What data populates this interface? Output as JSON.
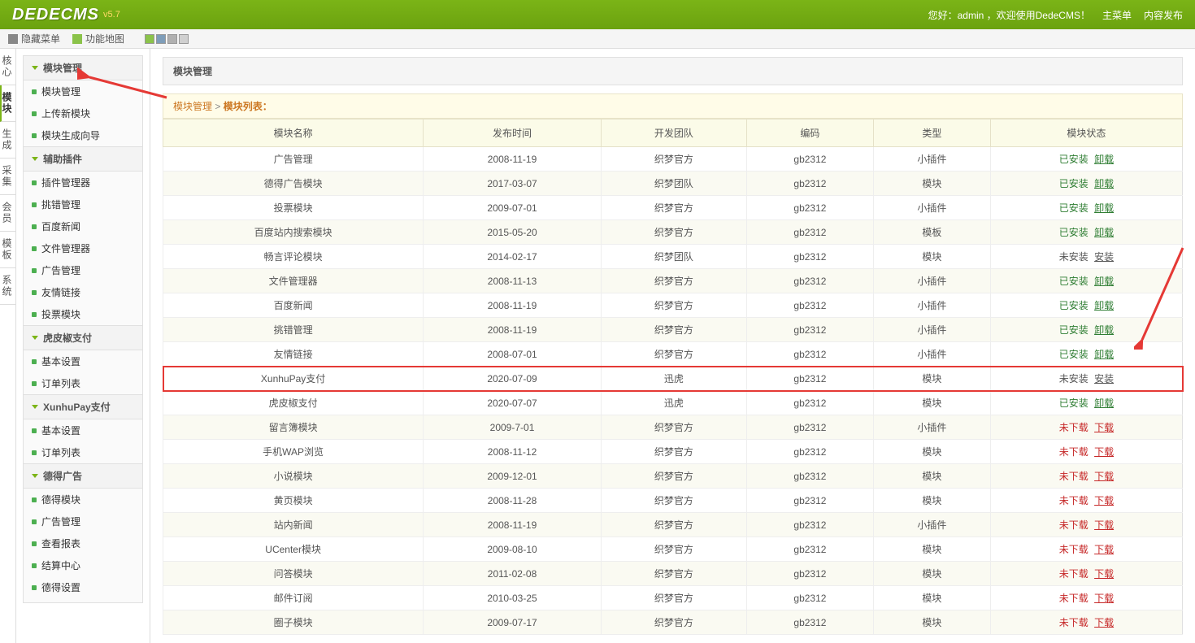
{
  "header": {
    "logo": "DEDECMS",
    "version": "v5.7",
    "welcome": "您好：admin ，欢迎使用DedeCMS！",
    "main_menu": "主菜单",
    "content_publish": "内容发布"
  },
  "toolbar": {
    "hide_menu": "隐藏菜单",
    "site_map": "功能地图"
  },
  "vert_tabs": [
    "核心",
    "模块",
    "生成",
    "采集",
    "会员",
    "模板",
    "系统"
  ],
  "vert_active_index": 1,
  "sidebar": [
    {
      "title": "模块管理",
      "items": [
        "模块管理",
        "上传新模块",
        "模块生成向导"
      ]
    },
    {
      "title": "辅助插件",
      "items": [
        "插件管理器",
        "挑错管理",
        "百度新闻",
        "文件管理器",
        "广告管理",
        "友情链接",
        "投票模块"
      ]
    },
    {
      "title": "虎皮椒支付",
      "items": [
        "基本设置",
        "订单列表"
      ]
    },
    {
      "title": "XunhuPay支付",
      "items": [
        "基本设置",
        "订单列表"
      ]
    },
    {
      "title": "德得广告",
      "items": [
        "德得模块",
        "广告管理",
        "查看报表",
        "结算中心",
        "德得设置"
      ]
    }
  ],
  "main": {
    "title": "模块管理",
    "breadcrumb": {
      "a": "模块管理",
      "sep": ">",
      "b": "模块列表："
    },
    "columns": [
      "模块名称",
      "发布时间",
      "开发团队",
      "编码",
      "类型",
      "模块状态"
    ],
    "rows": [
      {
        "name": "广告管理",
        "date": "2008-11-19",
        "team": "织梦官方",
        "enc": "gb2312",
        "type": "小插件",
        "status": "installed"
      },
      {
        "name": "德得广告模块",
        "date": "2017-03-07",
        "team": "织梦团队",
        "enc": "gb2312",
        "type": "模块",
        "status": "installed"
      },
      {
        "name": "投票模块",
        "date": "2009-07-01",
        "team": "织梦官方",
        "enc": "gb2312",
        "type": "小插件",
        "status": "installed"
      },
      {
        "name": "百度站内搜索模块",
        "date": "2015-05-20",
        "team": "织梦官方",
        "enc": "gb2312",
        "type": "模板",
        "status": "installed"
      },
      {
        "name": "畅言评论模块",
        "date": "2014-02-17",
        "team": "织梦团队",
        "enc": "gb2312",
        "type": "模块",
        "status": "not_installed"
      },
      {
        "name": "文件管理器",
        "date": "2008-11-13",
        "team": "织梦官方",
        "enc": "gb2312",
        "type": "小插件",
        "status": "installed"
      },
      {
        "name": "百度新闻",
        "date": "2008-11-19",
        "team": "织梦官方",
        "enc": "gb2312",
        "type": "小插件",
        "status": "installed"
      },
      {
        "name": "挑错管理",
        "date": "2008-11-19",
        "team": "织梦官方",
        "enc": "gb2312",
        "type": "小插件",
        "status": "installed"
      },
      {
        "name": "友情链接",
        "date": "2008-07-01",
        "team": "织梦官方",
        "enc": "gb2312",
        "type": "小插件",
        "status": "installed"
      },
      {
        "name": "XunhuPay支付",
        "date": "2020-07-09",
        "team": "迅虎",
        "enc": "gb2312",
        "type": "模块",
        "status": "not_installed",
        "highlight": true
      },
      {
        "name": "虎皮椒支付",
        "date": "2020-07-07",
        "team": "迅虎",
        "enc": "gb2312",
        "type": "模块",
        "status": "installed"
      },
      {
        "name": "留言簿模块",
        "date": "2009-7-01",
        "team": "织梦官方",
        "enc": "gb2312",
        "type": "小插件",
        "status": "not_downloaded"
      },
      {
        "name": "手机WAP浏览",
        "date": "2008-11-12",
        "team": "织梦官方",
        "enc": "gb2312",
        "type": "模块",
        "status": "not_downloaded"
      },
      {
        "name": "小说模块",
        "date": "2009-12-01",
        "team": "织梦官方",
        "enc": "gb2312",
        "type": "模块",
        "status": "not_downloaded"
      },
      {
        "name": "黄页模块",
        "date": "2008-11-28",
        "team": "织梦官方",
        "enc": "gb2312",
        "type": "模块",
        "status": "not_downloaded"
      },
      {
        "name": "站内新闻",
        "date": "2008-11-19",
        "team": "织梦官方",
        "enc": "gb2312",
        "type": "小插件",
        "status": "not_downloaded"
      },
      {
        "name": "UCenter模块",
        "date": "2009-08-10",
        "team": "织梦官方",
        "enc": "gb2312",
        "type": "模块",
        "status": "not_downloaded"
      },
      {
        "name": "问答模块",
        "date": "2011-02-08",
        "team": "织梦官方",
        "enc": "gb2312",
        "type": "模块",
        "status": "not_downloaded"
      },
      {
        "name": "邮件订阅",
        "date": "2010-03-25",
        "team": "织梦官方",
        "enc": "gb2312",
        "type": "模块",
        "status": "not_downloaded"
      },
      {
        "name": "圈子模块",
        "date": "2009-07-17",
        "team": "织梦官方",
        "enc": "gb2312",
        "type": "模块",
        "status": "not_downloaded"
      }
    ],
    "status_labels": {
      "installed": "已安装",
      "not_installed": "未安装",
      "not_downloaded": "未下载"
    },
    "action_labels": {
      "uninstall": "卸载",
      "install": "安装",
      "download": "下载"
    }
  },
  "colors": {
    "swatches": [
      "#8bc34a",
      "#7e9db9",
      "#b0b0b0",
      "#d0d0d0"
    ]
  }
}
